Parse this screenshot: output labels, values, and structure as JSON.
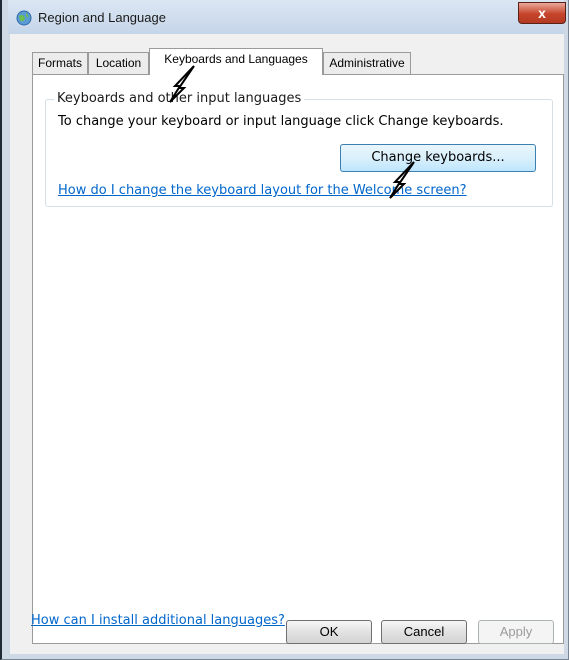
{
  "window": {
    "title": "Region and Language",
    "close_label": "x"
  },
  "tabs": [
    {
      "label": "Formats",
      "active": false
    },
    {
      "label": "Location",
      "active": false
    },
    {
      "label": "Keyboards and Languages",
      "active": true
    },
    {
      "label": "Administrative",
      "active": false
    }
  ],
  "group": {
    "title": "Keyboards and other input languages",
    "description": "To change your keyboard or input language click Change keyboards.",
    "change_button": "Change keyboards...",
    "welcome_link": "How do I change the keyboard layout for the Welcome screen?"
  },
  "install_link": "How can I install additional languages?",
  "buttons": {
    "ok": "OK",
    "cancel": "Cancel",
    "apply": "Apply"
  },
  "colors": {
    "link": "#0066cc",
    "titlebar": "#c5d5e9",
    "close": "#c6442a"
  }
}
